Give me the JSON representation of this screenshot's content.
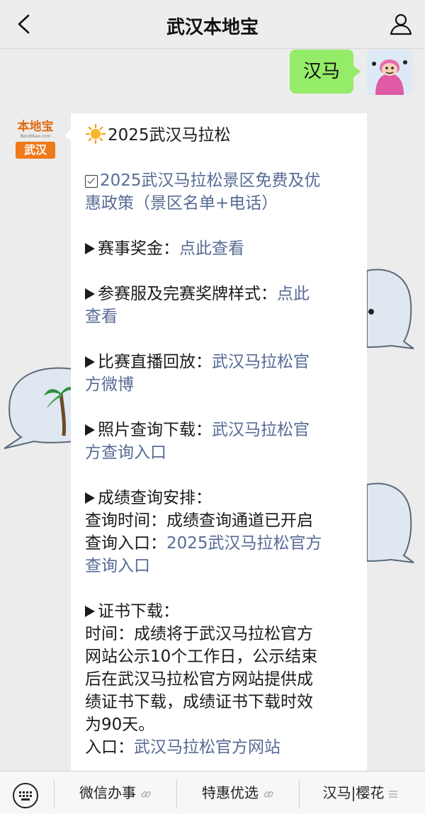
{
  "header": {
    "title": "武汉本地宝",
    "back_icon": "chevron-left-icon",
    "profile_icon": "person-icon"
  },
  "user_message": {
    "text": "汉马"
  },
  "bot_avatar": {
    "logo_text": "本地宝",
    "logo_url": "Bendibao.com",
    "city": "武汉"
  },
  "message": {
    "heading": "2025武汉马拉松",
    "policy_link": [
      "2025武汉马拉松景区免费及优",
      "惠政策（景区名单+电话）"
    ],
    "prize": {
      "label": "赛事奖金：",
      "link": "点此查看"
    },
    "kit": {
      "label": "参赛服及完赛奖牌样式：",
      "link1": "点此",
      "link2": "查看"
    },
    "live": {
      "label": "比赛直播回放：",
      "link1": "武汉马拉松官",
      "link2": "方微博"
    },
    "photo": {
      "label": "照片查询下载：",
      "link1": "武汉马拉松官",
      "link2": "方查询入口"
    },
    "score": {
      "title": "成绩查询安排：",
      "time_line": "查询时间：成绩查询通道已开启",
      "entry_label": "查询入口：",
      "entry_link1": "2025武汉马拉松官方",
      "entry_link2": "查询入口"
    },
    "cert": {
      "title": "证书下载：",
      "lines": [
        "时间：成绩将于武汉马拉松官方",
        "网站公示10个工作日，公示结束",
        "后在武汉马拉松官方网站提供成",
        "绩证书下载，成绩证书下载时效",
        "为90天。"
      ],
      "entry_label": "入口：",
      "entry_link": "武汉马拉松官方网站"
    }
  },
  "bottom_menu": {
    "keyboard_icon": "keyboard-icon",
    "items": [
      {
        "label": "微信办事",
        "icon": "link-icon"
      },
      {
        "label": "特惠优选",
        "icon": "link-icon"
      },
      {
        "label": "汉马|樱花",
        "icon": "menu-lines-icon"
      }
    ]
  },
  "colors": {
    "link": "#576b95",
    "user_bubble": "#95ec69",
    "header_bg": "#ededed",
    "chat_bg": "#ececec"
  }
}
